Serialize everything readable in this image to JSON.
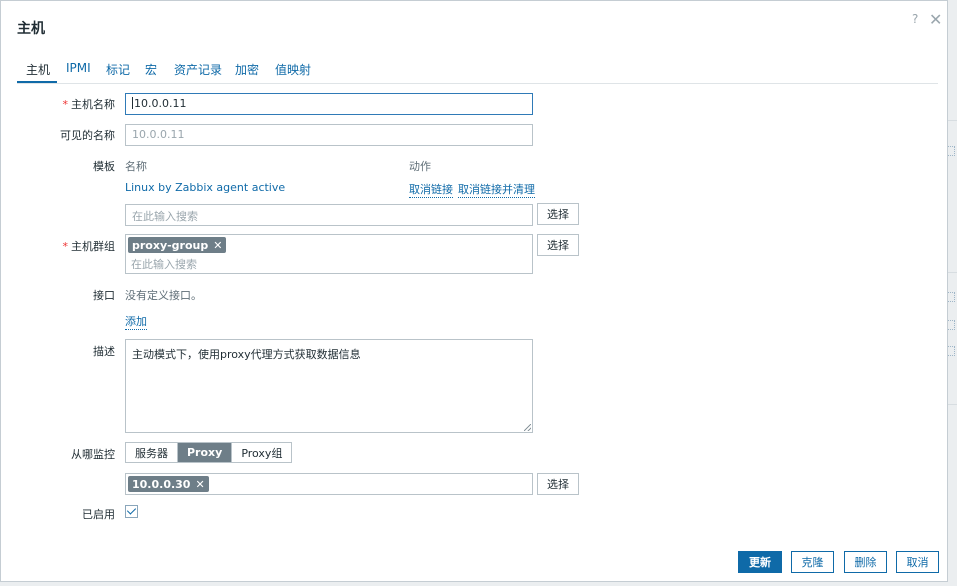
{
  "dialog": {
    "title": "主机",
    "help_glyph": "?",
    "close_glyph": "✕"
  },
  "tabs": [
    {
      "label": "主机",
      "active": true
    },
    {
      "label": "IPMI"
    },
    {
      "label": "标记"
    },
    {
      "label": "宏"
    },
    {
      "label": "资产记录"
    },
    {
      "label": "加密"
    },
    {
      "label": "值映射"
    }
  ],
  "form": {
    "required_mark": "*",
    "host_name": {
      "label": "主机名称",
      "value": "10.0.0.11"
    },
    "visible_name": {
      "label": "可见的名称",
      "value": "10.0.0.11"
    },
    "templates": {
      "label": "模板",
      "col_name": "名称",
      "col_action": "动作",
      "linked": "Linux by Zabbix agent active",
      "unlink": "取消链接",
      "unlink_clear": "取消链接并清理",
      "search_placeholder": "在此输入搜索",
      "select_button": "选择"
    },
    "host_groups": {
      "label": "主机群组",
      "tag": "proxy-group",
      "tag_remove": "✕",
      "search_placeholder": "在此输入搜索",
      "select_button": "选择"
    },
    "interfaces": {
      "label": "接口",
      "empty_text": "没有定义接口。",
      "add_link": "添加"
    },
    "description": {
      "label": "描述",
      "value": "主动模式下，使用proxy代理方式获取数据信息"
    },
    "monitored_by": {
      "label": "从哪监控",
      "options": [
        "服务器",
        "Proxy",
        "Proxy组"
      ],
      "selected": "Proxy",
      "proxy_tag": "10.0.0.30",
      "proxy_tag_remove": "✕",
      "select_button": "选择"
    },
    "enabled": {
      "label": "已启用",
      "checked": true
    }
  },
  "footer": {
    "update": "更新",
    "clone": "克隆",
    "delete": "删除",
    "cancel": "取消"
  }
}
